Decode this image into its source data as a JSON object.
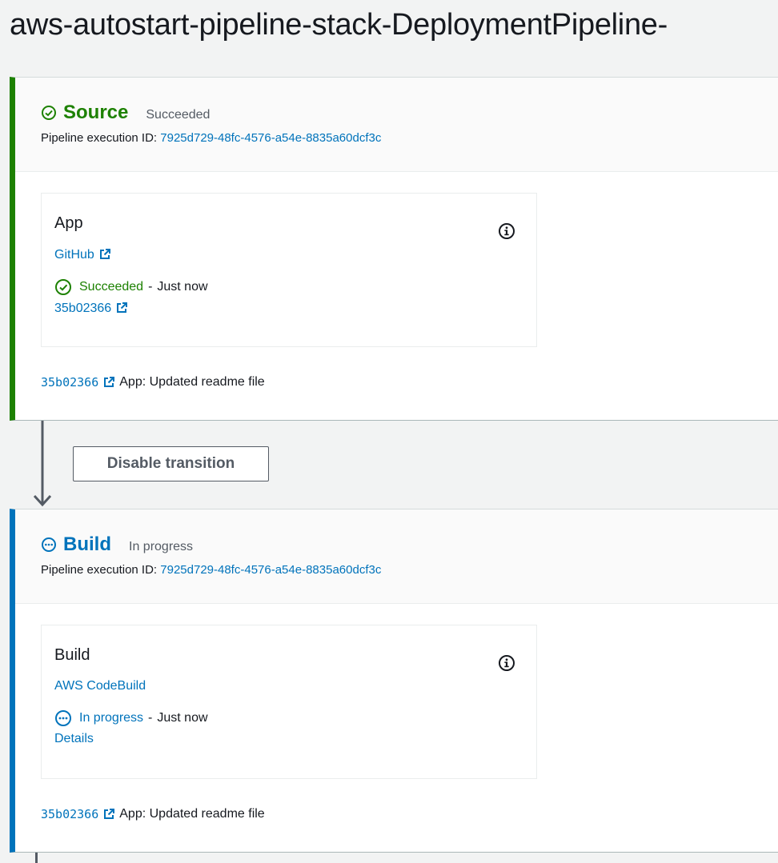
{
  "page": {
    "title": "aws-autostart-pipeline-stack-DeploymentPipeline-"
  },
  "stages": [
    {
      "name": "Source",
      "status": "Succeeded",
      "execution_label": "Pipeline execution ID:",
      "execution_id": "7925d729-48fc-4576-a54e-8835a60dcf3c",
      "color": "#1d8102",
      "icon": "check-circle-icon",
      "action": {
        "name": "App",
        "provider": "GitHub",
        "status": "Succeeded",
        "separator": "-",
        "time": "Just now",
        "link": "35b02366"
      },
      "commit": {
        "id": "35b02366",
        "message": "App: Updated readme file"
      }
    },
    {
      "name": "Build",
      "status": "In progress",
      "execution_label": "Pipeline execution ID:",
      "execution_id": "7925d729-48fc-4576-a54e-8835a60dcf3c",
      "color": "#0073bb",
      "icon": "in-progress-icon",
      "action": {
        "name": "Build",
        "provider": "AWS CodeBuild",
        "status": "In progress",
        "separator": "-",
        "time": "Just now",
        "link": "Details"
      },
      "commit": {
        "id": "35b02366",
        "message": "App: Updated readme file"
      }
    }
  ],
  "transition": {
    "button_label": "Disable transition"
  }
}
